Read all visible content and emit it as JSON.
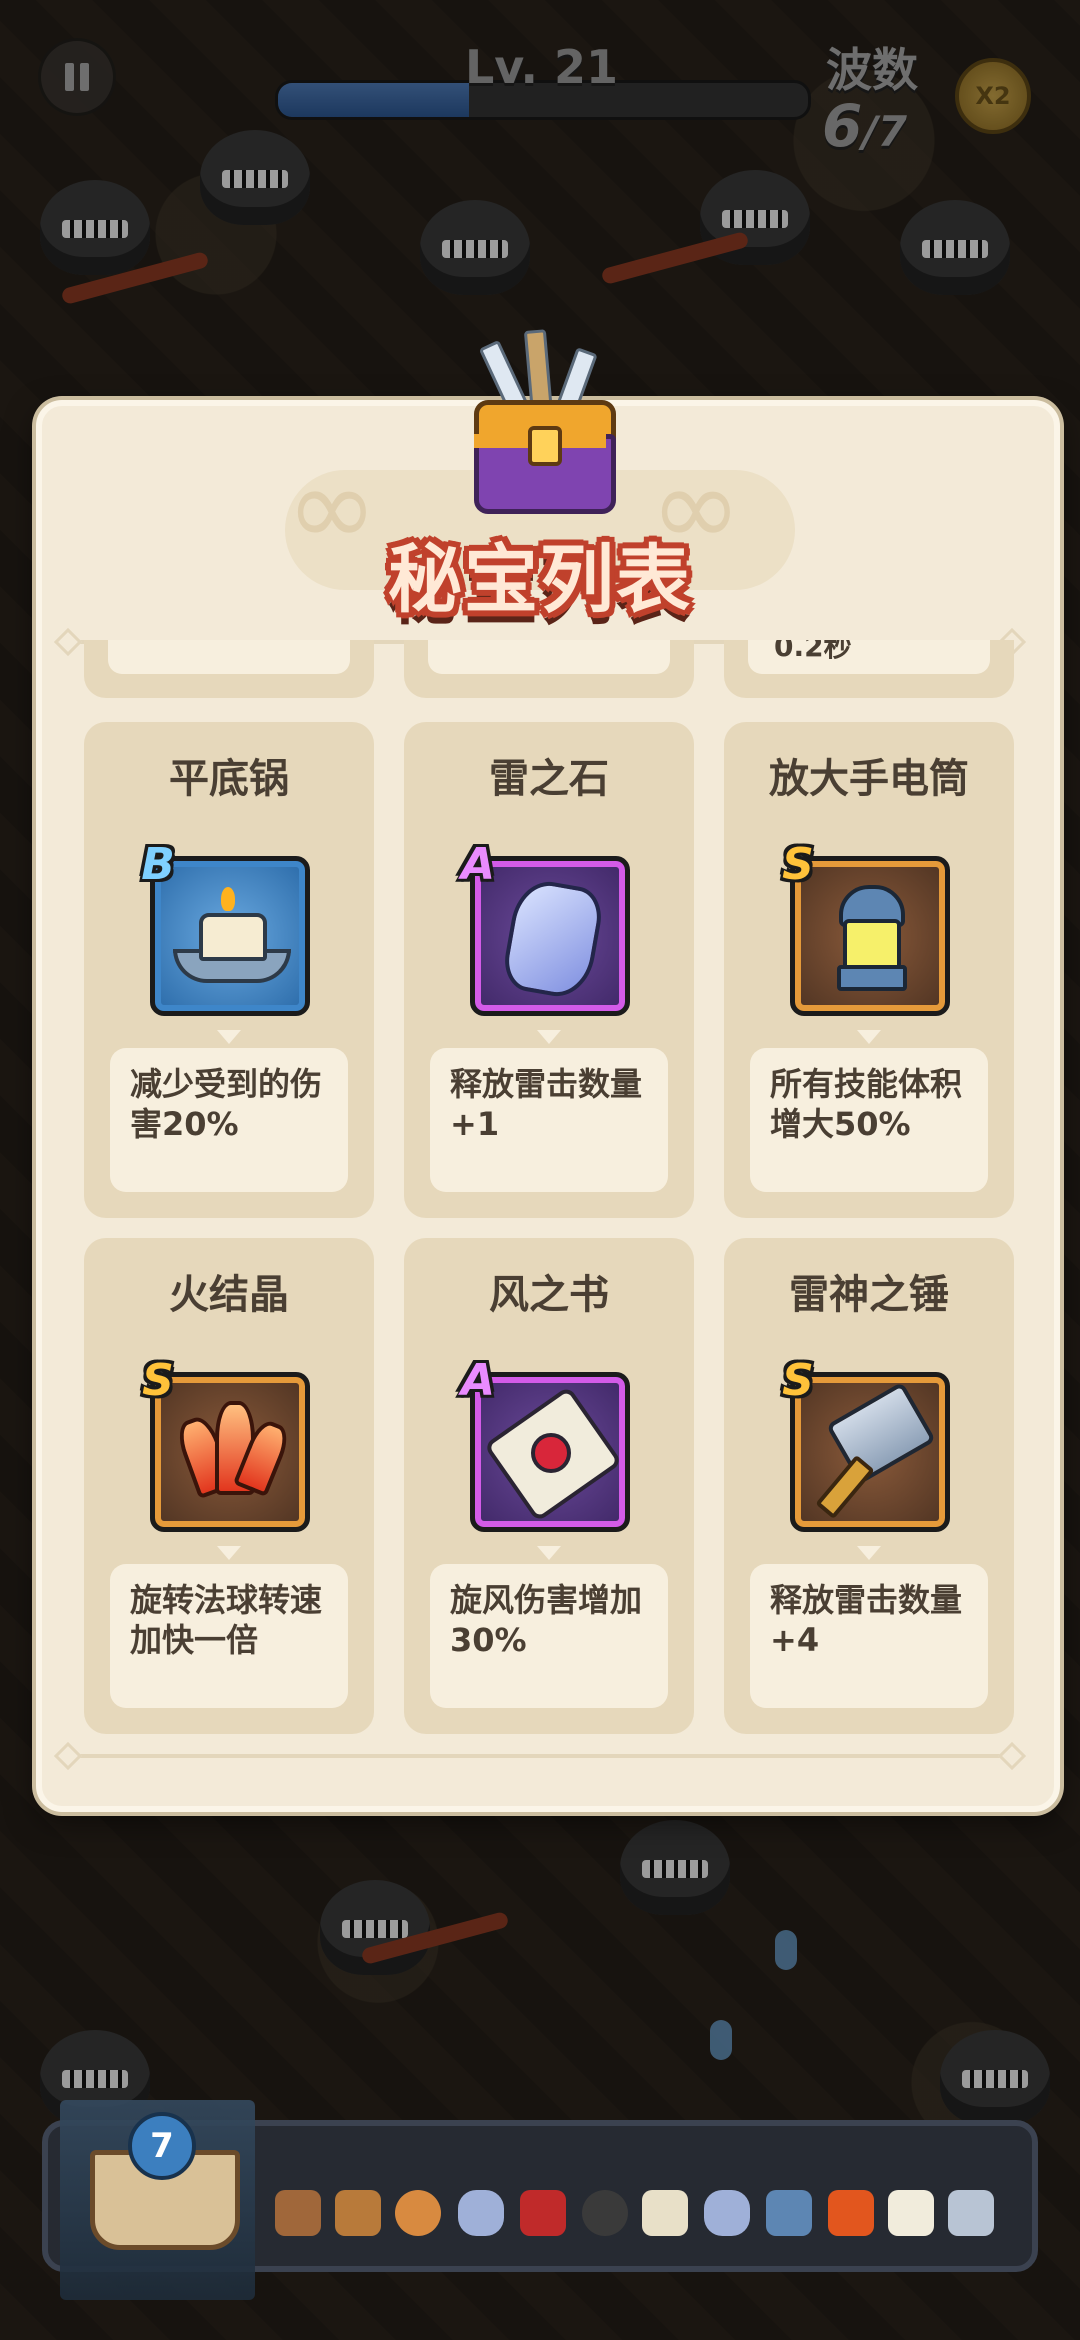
{
  "hud": {
    "level_label": "Lv. 21",
    "xp_progress": 0.36,
    "wave_label": "波数",
    "wave_current": "6",
    "wave_total": "/7",
    "speed_label": "X2"
  },
  "modal": {
    "title": "秘宝列表",
    "partial_row": [
      "",
      "",
      "0.2秒"
    ],
    "items": [
      {
        "name": "平底锅",
        "rank": "B",
        "desc_line1": "减少受到的伤",
        "desc_line2": "害20%",
        "icon": "candle-pan-icon"
      },
      {
        "name": "雷之石",
        "rank": "A",
        "desc_line1": "释放雷击数量",
        "desc_line2": "+1",
        "icon": "thunder-stone-icon"
      },
      {
        "name": "放大手电筒",
        "rank": "S",
        "desc_line1": "所有技能体积",
        "desc_line2": "增大50%",
        "icon": "lantern-icon"
      },
      {
        "name": "火结晶",
        "rank": "S",
        "desc_line1": "旋转法球转速",
        "desc_line2": "加快一倍",
        "icon": "fire-crystal-icon"
      },
      {
        "name": "风之书",
        "rank": "A",
        "desc_line1": "旋风伤害增加",
        "desc_line2": "30%",
        "icon": "wind-scroll-icon"
      },
      {
        "name": "雷神之锤",
        "rank": "S",
        "desc_line1": "释放雷击数量",
        "desc_line2": "+4",
        "icon": "thor-hammer-icon"
      }
    ]
  },
  "bottom_bar": {
    "book_count": "7",
    "inventory_icons": [
      "bag-icon",
      "chest-icon",
      "pot-icon",
      "stone-icon",
      "red-book-icon",
      "cannon-icon",
      "candle-icon",
      "stone-icon",
      "lantern-icon",
      "fire-crystal-icon",
      "scroll-icon",
      "hammer-icon"
    ]
  },
  "colors": {
    "rank_B": "#3e86c9",
    "rank_A": "#d35be8",
    "rank_S": "#e59a3a",
    "title_stroke": "#c0412c",
    "panel_bg": "#f3ead8"
  }
}
